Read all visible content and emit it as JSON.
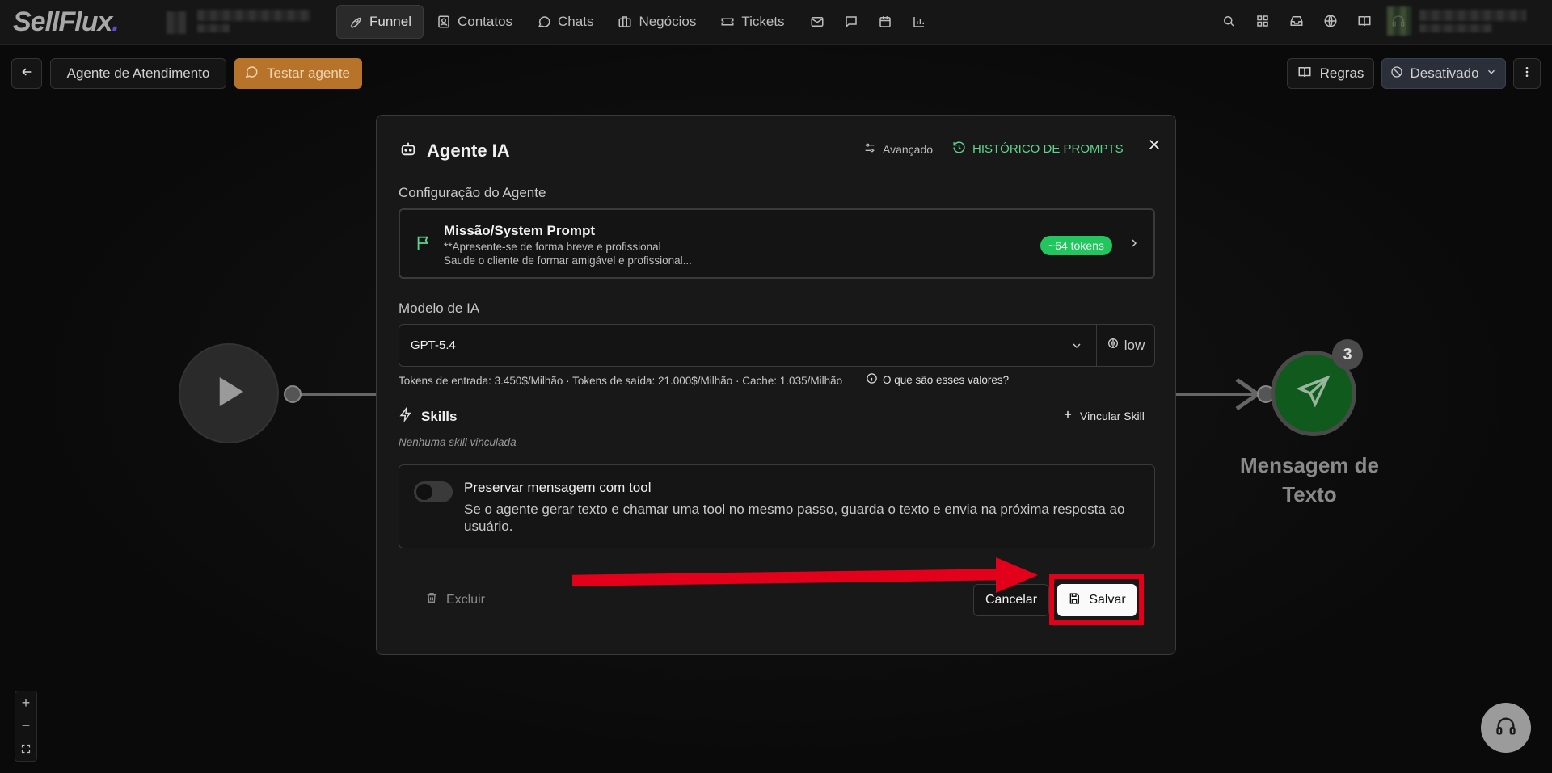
{
  "brand": {
    "logo": "SellFlux",
    "logo_dot": "."
  },
  "nav": {
    "items": [
      {
        "label": "Funnel",
        "icon": "rocket-icon",
        "active": true
      },
      {
        "label": "Contatos",
        "icon": "contacts-icon"
      },
      {
        "label": "Chats",
        "icon": "chat-icon"
      },
      {
        "label": "Negócios",
        "icon": "briefcase-icon"
      },
      {
        "label": "Tickets",
        "icon": "ticket-icon"
      }
    ],
    "small_icons": [
      "mail-icon",
      "message-square-icon",
      "calendar-icon",
      "bar-chart-icon"
    ],
    "right_icons": [
      "search-icon",
      "grid-icon",
      "inbox-icon",
      "globe-icon",
      "book-icon",
      "headset-icon"
    ]
  },
  "toolbar": {
    "flow_name": "Agente de Atendimento",
    "test_label": "Testar agente",
    "rules_label": "Regras",
    "status_label": "Desativado"
  },
  "canvas": {
    "message_node_label": "Mensagem de Texto",
    "message_node_count": "3"
  },
  "modal": {
    "title": "Agente IA",
    "advanced_label": "Avançado",
    "history_label": "HISTÓRICO DE PROMPTS",
    "config_section": "Configuração do Agente",
    "mission": {
      "title": "Missão/System Prompt",
      "line1": "**Apresente-se de forma breve e profissional",
      "line2": "Saude o cliente de formar amigável e profissional...",
      "tokens": "~64 tokens"
    },
    "model_section": "Modelo de IA",
    "model_value": "GPT-5.4",
    "effort_value": "low",
    "pricing": "Tokens de entrada: 3.450$/Milhão · Tokens de saída: 21.000$/Milhão · Cache: 1.035/Milhão",
    "pricing_info": "O que são esses valores?",
    "skills_title": "Skills",
    "link_skill": "Vincular Skill",
    "no_skill": "Nenhuma skill vinculada",
    "preserve": {
      "title": "Preservar mensagem com tool",
      "description": "Se o agente gerar texto e chamar uma tool no mesmo passo, guarda o texto e envia na próxima resposta ao usuário.",
      "enabled": false
    },
    "delete_label": "Excluir",
    "cancel_label": "Cancelar",
    "save_label": "Salvar"
  },
  "colors": {
    "accent_green": "#22c55e",
    "test_button": "#b8732a",
    "highlight_red": "#e3001b",
    "message_node": "#0f5a1c"
  }
}
